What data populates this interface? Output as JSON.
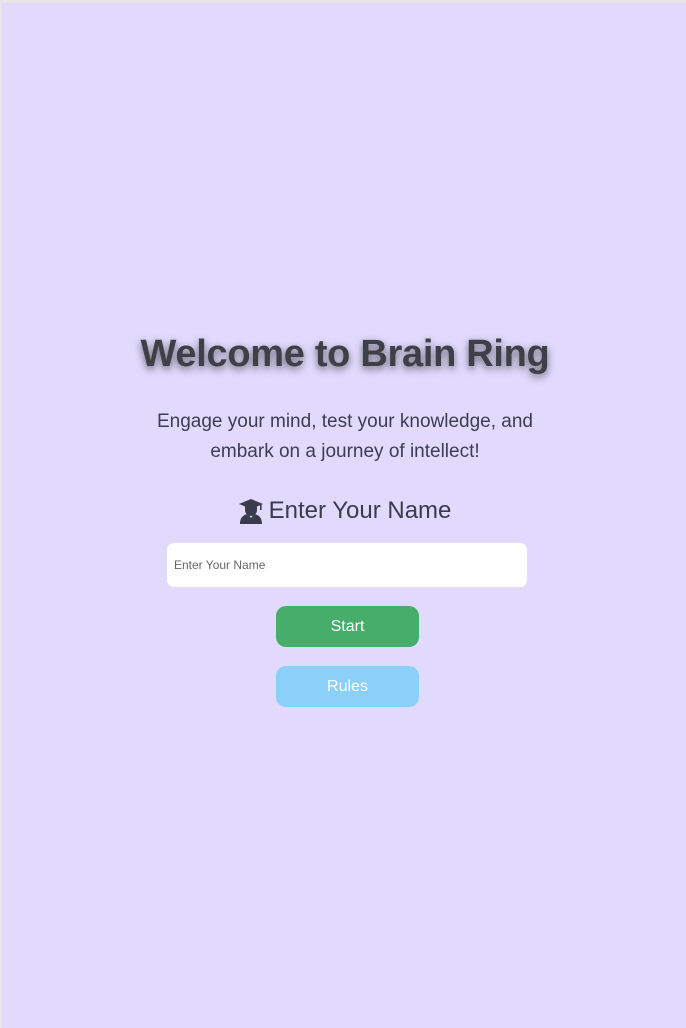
{
  "welcome": {
    "title": "Welcome to Brain Ring",
    "subtitle": "Engage your mind, test your knowledge, and embark on a journey of intellect!"
  },
  "name_section": {
    "icon": "graduate-icon",
    "label": "Enter Your Name",
    "input_value": "",
    "input_placeholder": "Enter Your Name"
  },
  "buttons": {
    "start_label": "Start",
    "rules_label": "Rules"
  },
  "colors": {
    "background": "#e1dafd",
    "start_button": "#47ad6b",
    "rules_button": "#8bd0f8",
    "text": "#3b3b4a"
  }
}
